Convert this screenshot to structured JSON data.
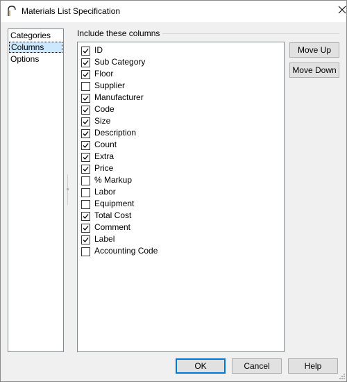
{
  "window": {
    "title": "Materials List Specification"
  },
  "sidebar": {
    "items": [
      {
        "label": "Categories",
        "selected": false
      },
      {
        "label": "Columns",
        "selected": true
      },
      {
        "label": "Options",
        "selected": false
      }
    ]
  },
  "columns_group": {
    "label": "Include these columns",
    "items": [
      {
        "label": "ID",
        "checked": true
      },
      {
        "label": "Sub Category",
        "checked": true
      },
      {
        "label": "Floor",
        "checked": true
      },
      {
        "label": "Supplier",
        "checked": false
      },
      {
        "label": "Manufacturer",
        "checked": true
      },
      {
        "label": "Code",
        "checked": true
      },
      {
        "label": "Size",
        "checked": true
      },
      {
        "label": "Description",
        "checked": true
      },
      {
        "label": "Count",
        "checked": true
      },
      {
        "label": "Extra",
        "checked": true
      },
      {
        "label": "Price",
        "checked": true
      },
      {
        "label": "% Markup",
        "checked": false
      },
      {
        "label": "Labor",
        "checked": false
      },
      {
        "label": "Equipment",
        "checked": false
      },
      {
        "label": "Total Cost",
        "checked": true
      },
      {
        "label": "Comment",
        "checked": true
      },
      {
        "label": "Label",
        "checked": true
      },
      {
        "label": "Accounting Code",
        "checked": false
      }
    ]
  },
  "buttons": {
    "move_up": "Move Up",
    "move_down": "Move Down",
    "ok": "OK",
    "cancel": "Cancel",
    "help": "Help"
  },
  "colors": {
    "accent": "#0078d7",
    "selection": "#cce8ff",
    "button_face": "#e1e1e1",
    "window_bg": "#f0f0f0"
  }
}
